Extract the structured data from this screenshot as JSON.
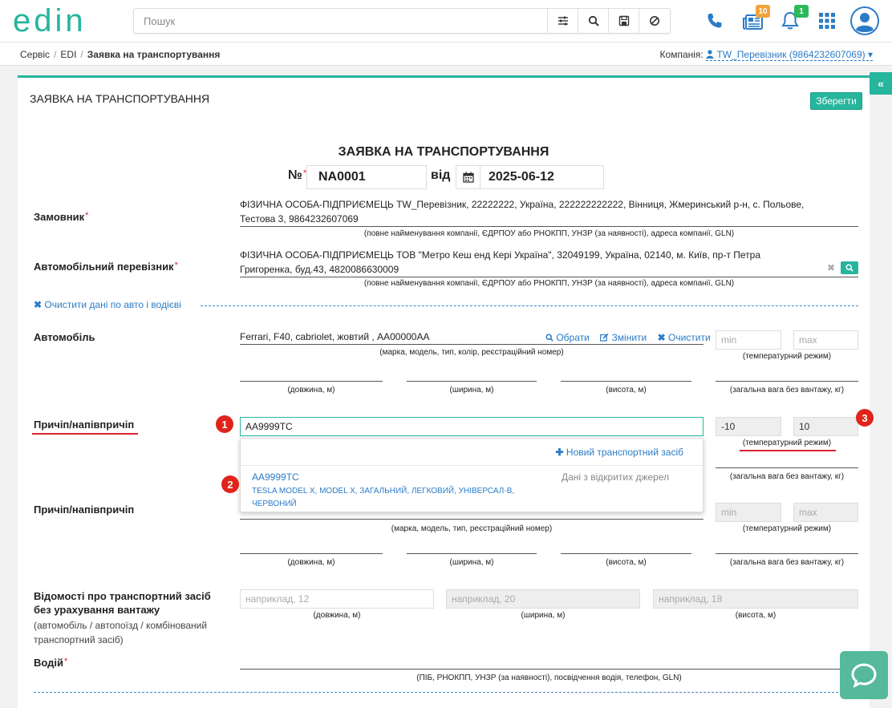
{
  "header": {
    "logo_text": "edin",
    "search_placeholder": "Пошук",
    "news_badge": "10",
    "notifications_badge": "1"
  },
  "breadcrumb": {
    "items": [
      "Сервіс",
      "EDI"
    ],
    "current": "Заявка на транспортування"
  },
  "company": {
    "label": "Компанія:",
    "value": "TW_Перевізник (9864232607069)"
  },
  "panel": {
    "title": "ЗАЯВКА НА ТРАНСПОРТУВАННЯ",
    "save_label": "Зберегти"
  },
  "document": {
    "title": "ЗАЯВКА НА ТРАНСПОРТУВАННЯ",
    "number_label": "№",
    "number_value": "NA0001",
    "date_label": "від",
    "date_value": "2025-06-12"
  },
  "customer": {
    "label": "Замовник",
    "line1": "ФІЗИЧНА ОСОБА-ПІДПРИЄМЕЦЬ TW_Перевізник, 22222222, Україна, 222222222222, Вінниця, Жмеринський р-н, с. Польове,",
    "line2": "Тестова 3, 9864232607069",
    "hint": "(повне найменування компанії, ЄДРПОУ або РНОКПП, УНЗР (за наявності), адреса компанії, GLN)"
  },
  "carrier": {
    "label": "Автомобільний перевізник",
    "line1": "ФІЗИЧНА ОСОБА-ПІДПРИЄМЕЦЬ ТОВ \"Метро Кеш енд Кері Україна\", 32049199, Україна, 02140, м. Київ, пр-т Петра",
    "line2": "Григоренка, буд.43, 4820086630009",
    "hint": "(повне найменування компанії, ЄДРПОУ або РНОКПП, УНЗР (за наявності), адреса компанії, GLN)"
  },
  "clear_link": "Очистити дані по авто і водієві",
  "vehicle": {
    "label": "Автомобіль",
    "value": "Ferrari, F40, cabriolet, жовтий , AA00000AA",
    "choose": "Обрати",
    "change": "Змінити",
    "clear": "Очистити",
    "hint": "(марка, модель, тип, колір, реєстраційний номер)",
    "temp_min_placeholder": "min",
    "temp_max_placeholder": "max",
    "temp_hint": "(температурний режим)",
    "length_hint": "(довжина, м)",
    "width_hint": "(ширина, м)",
    "height_hint": "(висота, м)",
    "weight_hint": "(загальна вага без вантажу, кг)"
  },
  "trailer1": {
    "label": "Причіп/напівпричіп",
    "value": "AA9999TC",
    "temp_min": "-10",
    "temp_max": "10",
    "temp_hint": "(температурний режим)",
    "weight_hint": "(загальна вага без вантажу, кг)"
  },
  "dropdown": {
    "new_vehicle": "Новий транспортний засіб",
    "item_title": "AA9999TC",
    "item_desc": "TESLA MODEL X, MODEL X, ЗАГАЛЬНИЙ, ЛЕГКОВИЙ, УНІВЕРСАЛ-В, ЧЕРВОНИЙ",
    "item_source": "Дані з відкритих джерел"
  },
  "trailer2": {
    "label": "Причіп/напівпричіп",
    "hint": "(марка, модель, тип, реєстраційний номер)",
    "temp_min_placeholder": "min",
    "temp_max_placeholder": "max",
    "temp_hint": "(температурний режим)",
    "length_hint": "(довжина, м)",
    "width_hint": "(ширина, м)",
    "height_hint": "(висота, м)",
    "weight_hint": "(загальна вага без вантажу, кг)"
  },
  "dimensions": {
    "label": "Відомості про транспортний засіб без урахування вантажу",
    "sublabel": "(автомобіль / автопоїзд / комбінований транспортний засіб)",
    "length_placeholder": "наприклад, 12",
    "width_placeholder": "наприклад, 20",
    "height_placeholder": "наприклад, 18",
    "length_hint": "(довжина, м)",
    "width_hint": "(ширина, м)",
    "height_hint": "(висота, м)"
  },
  "driver": {
    "label": "Водій",
    "hint": "(ПІБ, РНОКПП, УНЗР (за наявності), посвідчення водія, телефон, GLN)"
  },
  "markers": [
    "1",
    "2",
    "3"
  ],
  "colors": {
    "accent": "#26b59d",
    "link": "#2a7cc7",
    "marker": "#e0231b",
    "badge_orange": "#f0a43a",
    "badge_green": "#2eb85c"
  }
}
